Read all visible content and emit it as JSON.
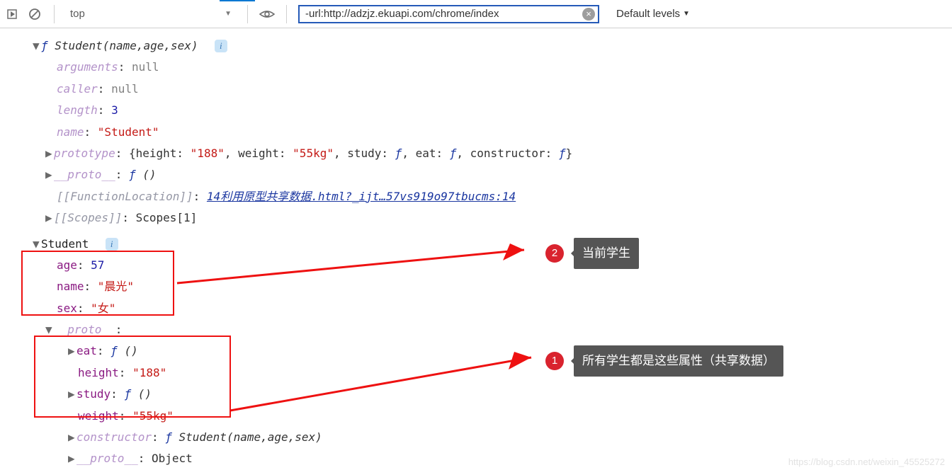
{
  "toolbar": {
    "context": "top",
    "filter": "-url:http://adzjz.ekuapi.com/chrome/index",
    "levels": "Default levels"
  },
  "fn": {
    "header": "Student(name,age,sex)",
    "arguments": {
      "label": "arguments",
      "value": "null"
    },
    "caller": {
      "label": "caller",
      "value": "null"
    },
    "length": {
      "label": "length",
      "value": "3"
    },
    "name": {
      "label": "name",
      "value": "\"Student\""
    },
    "prototype": {
      "label": "prototype",
      "open": "{height: ",
      "h": "\"188\"",
      "mid1": ", weight: ",
      "w": "\"55kg\"",
      "mid2": ", study: ",
      "mid3": ", eat: ",
      "mid4": ", constructor: ",
      "close": "}"
    },
    "proto": {
      "label": "__proto__",
      "sig": " ()"
    },
    "functionLocation": {
      "label": "[[FunctionLocation]]",
      "link": "14利用原型共享数据.html?_ijt…57vs919o97tbucms:14"
    },
    "scopes": {
      "label": "[[Scopes]]",
      "value": "Scopes[1]"
    }
  },
  "instance": {
    "header": "Student",
    "age": {
      "label": "age",
      "value": "57"
    },
    "name": {
      "label": "name",
      "value": "\"晨光\""
    },
    "sex": {
      "label": "sex",
      "value": "\"女\""
    },
    "proto": {
      "label": "__proto__"
    },
    "eat": {
      "label": "eat",
      "sig": " ()"
    },
    "height": {
      "label": "height",
      "value": "\"188\""
    },
    "study": {
      "label": "study",
      "sig": " ()"
    },
    "weight": {
      "label": "weight",
      "value": "\"55kg\""
    },
    "constructor": {
      "label": "constructor",
      "sig": " Student(name,age,sex)"
    },
    "proto2": {
      "label": "__proto__",
      "value": "Object"
    }
  },
  "callouts": {
    "c2": "当前学生",
    "c1": "所有学生都是这些属性（共享数据）"
  },
  "watermark": "https://blog.csdn.net/weixin_45525272",
  "glyph": {
    "f": "ƒ",
    "i": "i",
    "down": "▼",
    "right": "▶"
  }
}
